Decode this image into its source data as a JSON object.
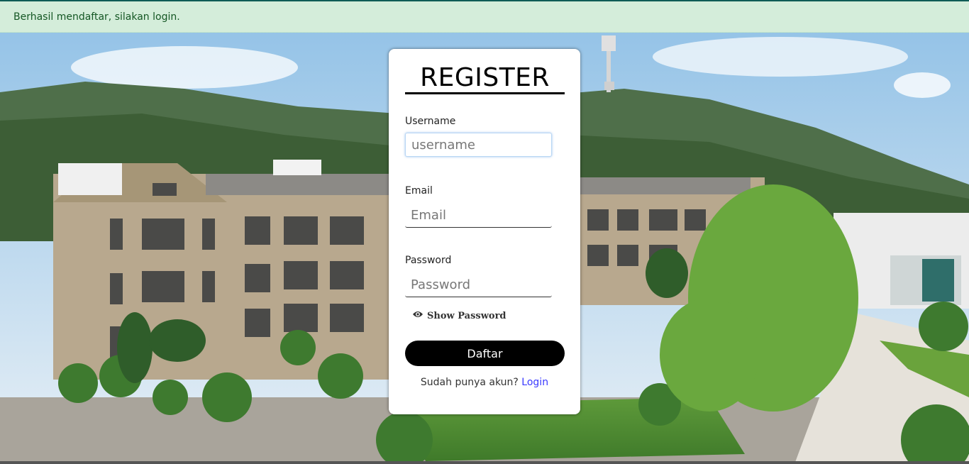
{
  "alert": {
    "message": "Berhasil mendaftar, silakan login."
  },
  "form": {
    "title": "REGISTER",
    "username": {
      "label": "Username",
      "placeholder": "username",
      "value": ""
    },
    "email": {
      "label": "Email",
      "placeholder": "Email",
      "value": ""
    },
    "password": {
      "label": "Password",
      "placeholder": "Password",
      "value": ""
    },
    "show_password": {
      "label": "Show Password",
      "icon": "eye-icon"
    },
    "submit_label": "Daftar",
    "footer_text": "Sudah punya akun?",
    "login_link": "Login"
  },
  "colors": {
    "alert_bg": "#d4edda",
    "alert_text": "#155724",
    "button_bg": "#000000",
    "link": "#3a3aff"
  },
  "background": {
    "description_icon": "campus-photo"
  }
}
